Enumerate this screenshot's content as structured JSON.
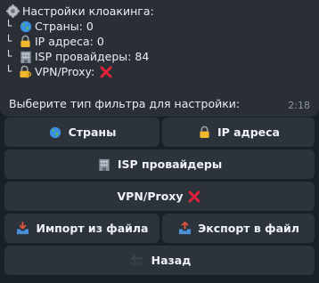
{
  "message": {
    "title": "Настройки клоакинга:",
    "items": [
      {
        "label": "Страны: 0",
        "icon": "globe-icon"
      },
      {
        "label": "IP адреса: 0",
        "icon": "lock-icon"
      },
      {
        "label": "ISP провайдеры: 84",
        "icon": "building-icon"
      },
      {
        "label": "VPN/Proxy:",
        "icon": "lock-key-icon",
        "status_icon": "cross-mark-icon"
      }
    ],
    "prompt": "Выберите тип фильтра для настройки:",
    "time": "2:18"
  },
  "keyboard": {
    "countries": "Страны",
    "ip": "IP адреса",
    "isp": "ISP провайдеры",
    "vpn": "VPN/Proxy",
    "import": "Импорт из файла",
    "export": "Экспорт в файл",
    "back": "Назад",
    "back_icon_text": "BACK"
  },
  "colors": {
    "background": "#1a2028",
    "bubble": "#2a2f36",
    "button": "#2c333b",
    "cross": "#e0233a"
  }
}
